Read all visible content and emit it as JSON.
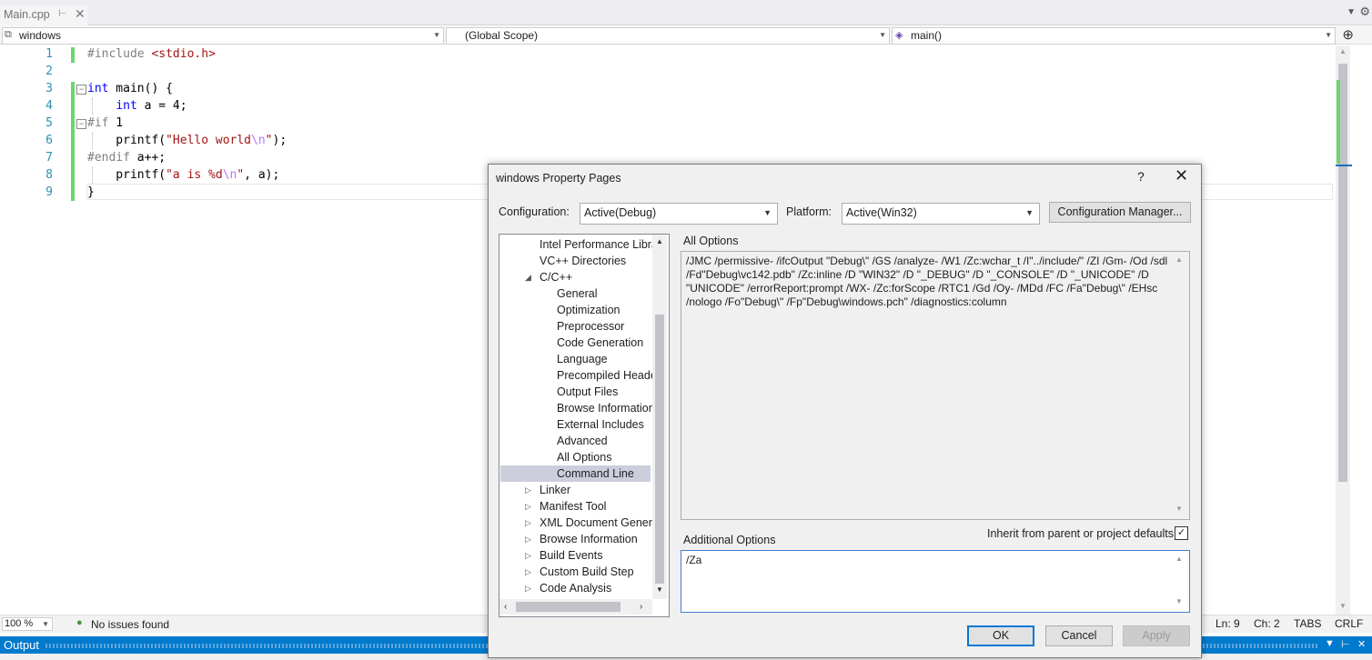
{
  "tab": {
    "title": "Main.cpp",
    "pin": "⊢",
    "close": "✕"
  },
  "navbar": {
    "project": "windows",
    "scope": "(Global Scope)",
    "member": "main()"
  },
  "code": {
    "line_numbers": [
      "1",
      "2",
      "3",
      "4",
      "5",
      "6",
      "7",
      "8",
      "9"
    ],
    "lines": [
      "#include <stdio.h>",
      "",
      "int main() {",
      "    int a = 4;",
      "#if 1",
      "    printf(\"Hello world\\n\");",
      "#endif a++;",
      "    printf(\"a is %d\\n\", a);",
      "}"
    ]
  },
  "status": {
    "zoom": "100 %",
    "issues": "No issues found",
    "ln": "Ln: 9",
    "ch": "Ch: 2",
    "tabs": "TABS",
    "eol": "CRLF"
  },
  "output": {
    "title": "Output"
  },
  "dialog": {
    "title": "windows Property Pages",
    "help": "?",
    "close": "✕",
    "config_label": "Configuration:",
    "config_value": "Active(Debug)",
    "platform_label": "Platform:",
    "platform_value": "Active(Win32)",
    "config_manager": "Configuration Manager...",
    "tree": [
      {
        "label": "Intel Performance Libra",
        "indent": 0,
        "exp": ""
      },
      {
        "label": "VC++ Directories",
        "indent": 0,
        "exp": ""
      },
      {
        "label": "C/C++",
        "indent": 0,
        "exp": "open"
      },
      {
        "label": "General",
        "indent": 1,
        "exp": ""
      },
      {
        "label": "Optimization",
        "indent": 1,
        "exp": ""
      },
      {
        "label": "Preprocessor",
        "indent": 1,
        "exp": ""
      },
      {
        "label": "Code Generation",
        "indent": 1,
        "exp": ""
      },
      {
        "label": "Language",
        "indent": 1,
        "exp": ""
      },
      {
        "label": "Precompiled Heade",
        "indent": 1,
        "exp": ""
      },
      {
        "label": "Output Files",
        "indent": 1,
        "exp": ""
      },
      {
        "label": "Browse Information",
        "indent": 1,
        "exp": ""
      },
      {
        "label": "External Includes",
        "indent": 1,
        "exp": ""
      },
      {
        "label": "Advanced",
        "indent": 1,
        "exp": ""
      },
      {
        "label": "All Options",
        "indent": 1,
        "exp": ""
      },
      {
        "label": "Command Line",
        "indent": 1,
        "exp": "",
        "selected": true
      },
      {
        "label": "Linker",
        "indent": 0,
        "exp": "closed"
      },
      {
        "label": "Manifest Tool",
        "indent": 0,
        "exp": "closed"
      },
      {
        "label": "XML Document Genera",
        "indent": 0,
        "exp": "closed"
      },
      {
        "label": "Browse Information",
        "indent": 0,
        "exp": "closed"
      },
      {
        "label": "Build Events",
        "indent": 0,
        "exp": "closed"
      },
      {
        "label": "Custom Build Step",
        "indent": 0,
        "exp": "closed"
      },
      {
        "label": "Code Analysis",
        "indent": 0,
        "exp": "closed"
      }
    ],
    "all_options_label": "All Options",
    "all_options_text": "/JMC /permissive- /ifcOutput \"Debug\\\" /GS /analyze- /W1 /Zc:wchar_t /I\"../include/\" /ZI /Gm- /Od /sdl /Fd\"Debug\\vc142.pdb\" /Zc:inline /D \"WIN32\" /D \"_DEBUG\" /D \"_CONSOLE\" /D \"_UNICODE\" /D \"UNICODE\" /errorReport:prompt /WX- /Zc:forScope /RTC1 /Gd /Oy- /MDd /FC /Fa\"Debug\\\" /EHsc /nologo /Fo\"Debug\\\" /Fp\"Debug\\windows.pch\" /diagnostics:column",
    "additional_label": "Additional Options",
    "additional_value": "/Za",
    "inherit_label": "Inherit from parent or project defaults",
    "inherit_checked": "✓",
    "ok": "OK",
    "cancel": "Cancel",
    "apply": "Apply"
  }
}
